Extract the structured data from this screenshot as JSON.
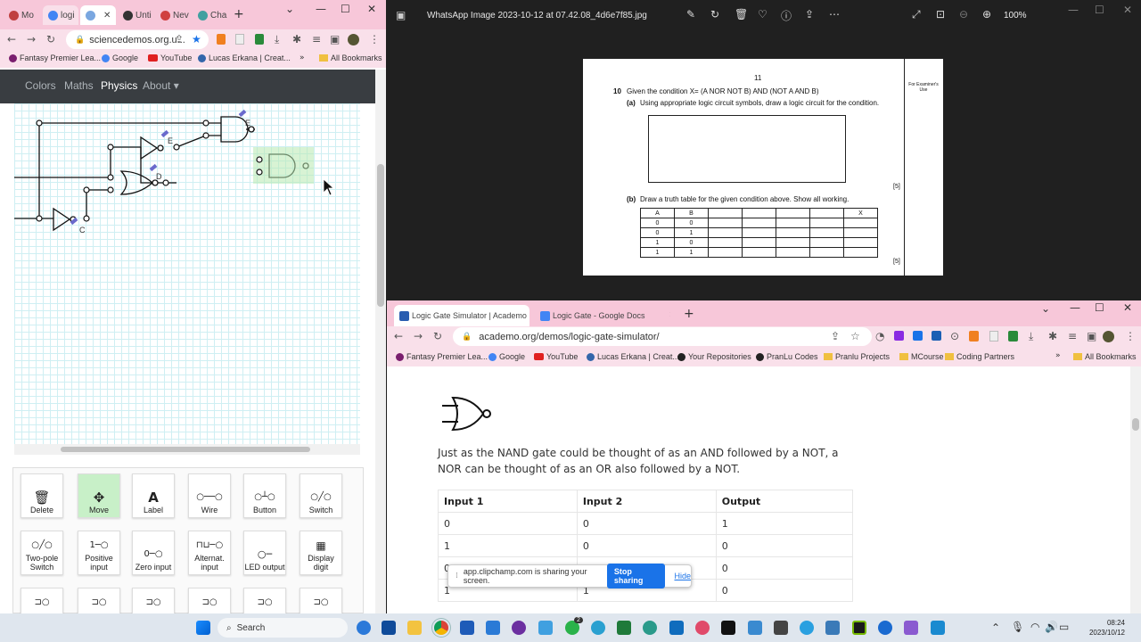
{
  "left_browser": {
    "tabs": [
      {
        "label": "Mo",
        "color": "#c04040"
      },
      {
        "label": "logi",
        "color": "#4285f4"
      },
      {
        "label": "",
        "color": "#7aa7e0"
      },
      {
        "label": "Unti",
        "color": "#333333"
      },
      {
        "label": "Nev",
        "color": "#d04040"
      },
      {
        "label": "Cha",
        "color": "#40a0a0"
      }
    ],
    "address": "sciencedemos.org.u...",
    "bookmarks": [
      "Fantasy Premier Lea...",
      "Google",
      "YouTube",
      "Lucas Erkana | Creat...",
      "All Bookmarks"
    ],
    "nav": {
      "colors": "Colors",
      "maths": "Maths",
      "physics": "Physics",
      "about": "About ▾"
    },
    "labels": {
      "c": "C",
      "d": "D",
      "e1": "E",
      "e2": "E"
    },
    "tools_row1": [
      "Delete",
      "Move",
      "Label",
      "Wire",
      "Button",
      "Switch"
    ],
    "tools_row2": [
      "Two-pole Switch",
      "Positive input",
      "Zero input",
      "Alternat. input",
      "LED output",
      "Display digit"
    ]
  },
  "viewer": {
    "title": "WhatsApp Image 2023-10-12 at 07.42.08_4d6e7f85.jpg",
    "zoom": "100%",
    "paper": {
      "page_num": "11",
      "q_num": "10",
      "q_text": "Given the condition X= (A NOR NOT B) AND (NOT A AND B)",
      "part_a_label": "(a)",
      "part_a": "Using appropriate logic circuit symbols, draw a logic circuit for the condition.",
      "part_b_label": "(b)",
      "part_b": "Draw a truth table for the given condition above.  Show all working.",
      "marks": "[5]",
      "margin_note": "For Examiner's Use",
      "table_head": [
        "A",
        "B",
        "",
        "",
        "",
        "",
        "X"
      ],
      "table_rows": [
        [
          "0",
          "0"
        ],
        [
          "0",
          "1"
        ],
        [
          "1",
          "0"
        ],
        [
          "1",
          "1"
        ]
      ]
    }
  },
  "right_browser": {
    "tabs": [
      {
        "label": "Logic Gate Simulator | Academo",
        "color": "#2a5db0"
      },
      {
        "label": "Logic Gate - Google Docs",
        "color": "#4285f4"
      }
    ],
    "address": "academo.org/demos/logic-gate-simulator/",
    "bookmarks": [
      "Fantasy Premier Lea...",
      "Google",
      "YouTube",
      "Lucas Erkana | Creat...",
      "Your Repositories",
      "PranLu Codes",
      "Pranlu Projects",
      "MCourse",
      "Coding Partners",
      "All Bookmarks"
    ],
    "paragraph": "Just as the NAND gate could be thought of as an AND followed by a NOT, a NOR can be thought of as an OR also followed by a NOT.",
    "table": {
      "headers": [
        "Input 1",
        "Input 2",
        "Output"
      ],
      "rows": [
        [
          "0",
          "0",
          "1"
        ],
        [
          "1",
          "0",
          "0"
        ],
        [
          "0",
          "1",
          "0"
        ],
        [
          "1",
          "1",
          "0"
        ]
      ]
    },
    "share": {
      "text": "app.clipchamp.com is sharing your screen.",
      "stop": "Stop sharing",
      "hide": "Hide"
    }
  },
  "taskbar": {
    "search": "Search",
    "time": "08:24",
    "date": "2023/10/12",
    "badge": "2"
  }
}
